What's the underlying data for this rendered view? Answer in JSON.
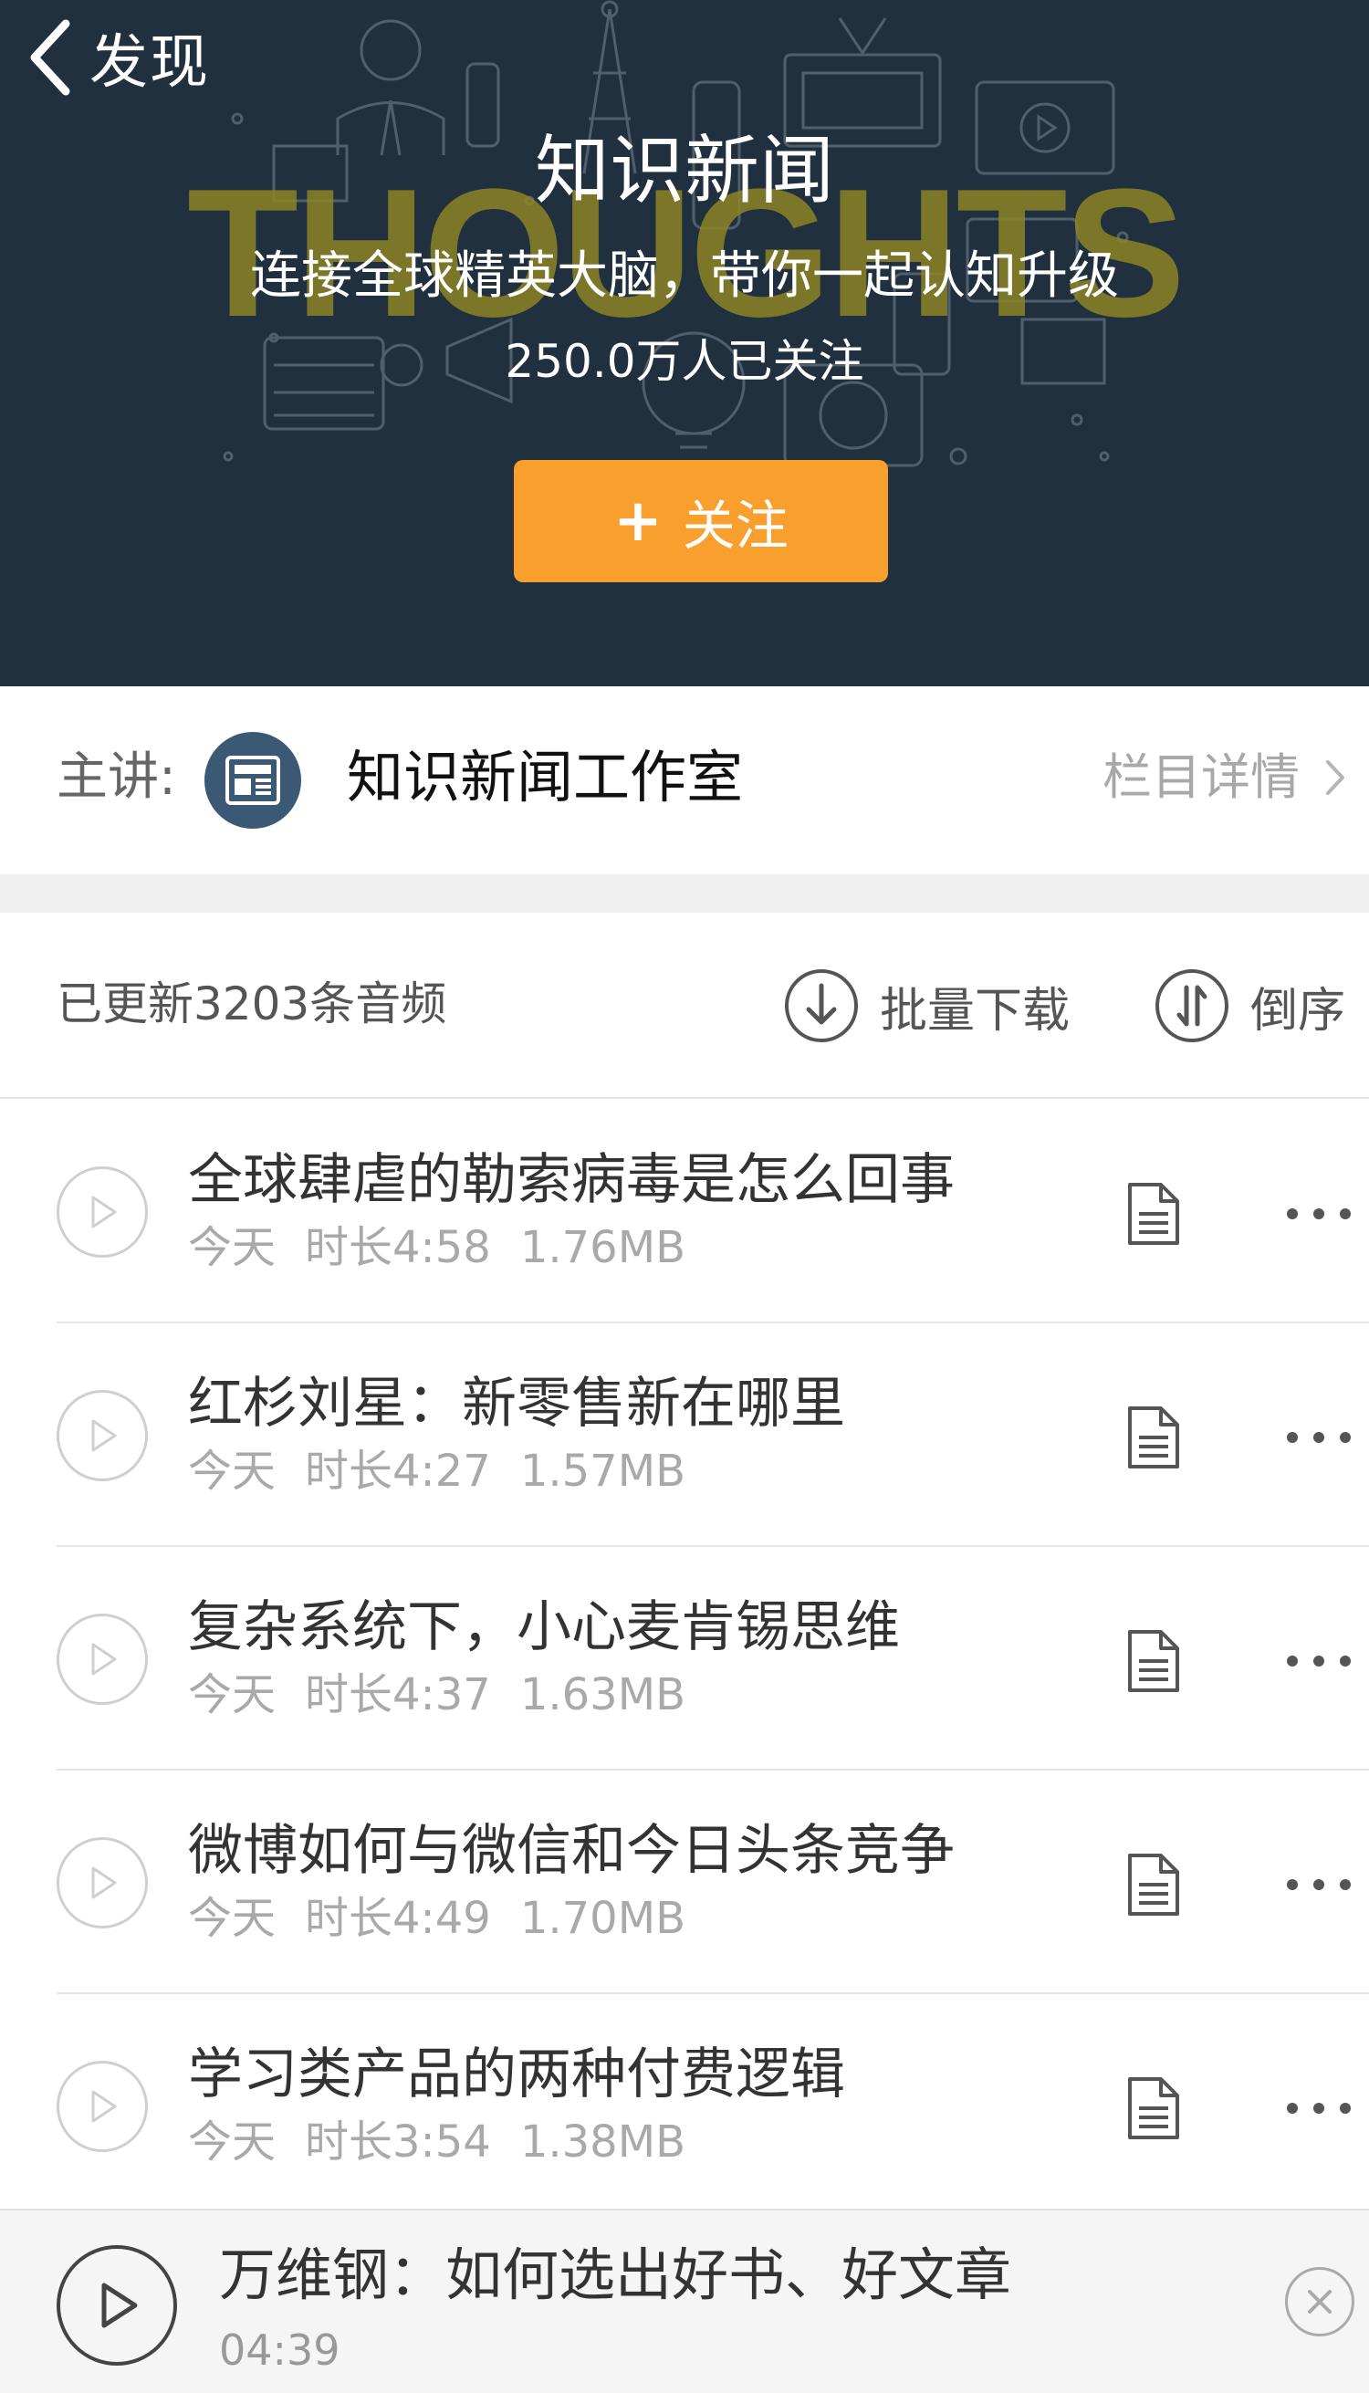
{
  "nav": {
    "back_label": "发现"
  },
  "header": {
    "watermark": "THOUGHTS",
    "title": "知识新闻",
    "subtitle": "连接全球精英大脑，带你一起认知升级",
    "followers": "250.0万人已关注",
    "follow_label": "关注"
  },
  "host": {
    "label": "主讲:",
    "name": "知识新闻工作室",
    "detail_label": "栏目详情"
  },
  "toolbar": {
    "count_text": "已更新3203条音频",
    "download_label": "批量下载",
    "sort_label": "倒序"
  },
  "episodes": [
    {
      "title": "全球肆虐的勒索病毒是怎么回事",
      "day": "今天",
      "duration": "时长4:58",
      "size": "1.76MB"
    },
    {
      "title": "红杉刘星：新零售新在哪里",
      "day": "今天",
      "duration": "时长4:27",
      "size": "1.57MB"
    },
    {
      "title": "复杂系统下，小心麦肯锡思维",
      "day": "今天",
      "duration": "时长4:37",
      "size": "1.63MB"
    },
    {
      "title": "微博如何与微信和今日头条竞争",
      "day": "今天",
      "duration": "时长4:49",
      "size": "1.70MB"
    },
    {
      "title": "学习类产品的两种付费逻辑",
      "day": "今天",
      "duration": "时长3:54",
      "size": "1.38MB"
    }
  ],
  "player": {
    "title": "万维钢：如何选出好书、好文章",
    "time": "04:39"
  },
  "colors": {
    "header_bg": "#21303f",
    "accent": "#f99f2d",
    "watermark": "#8d8425"
  }
}
